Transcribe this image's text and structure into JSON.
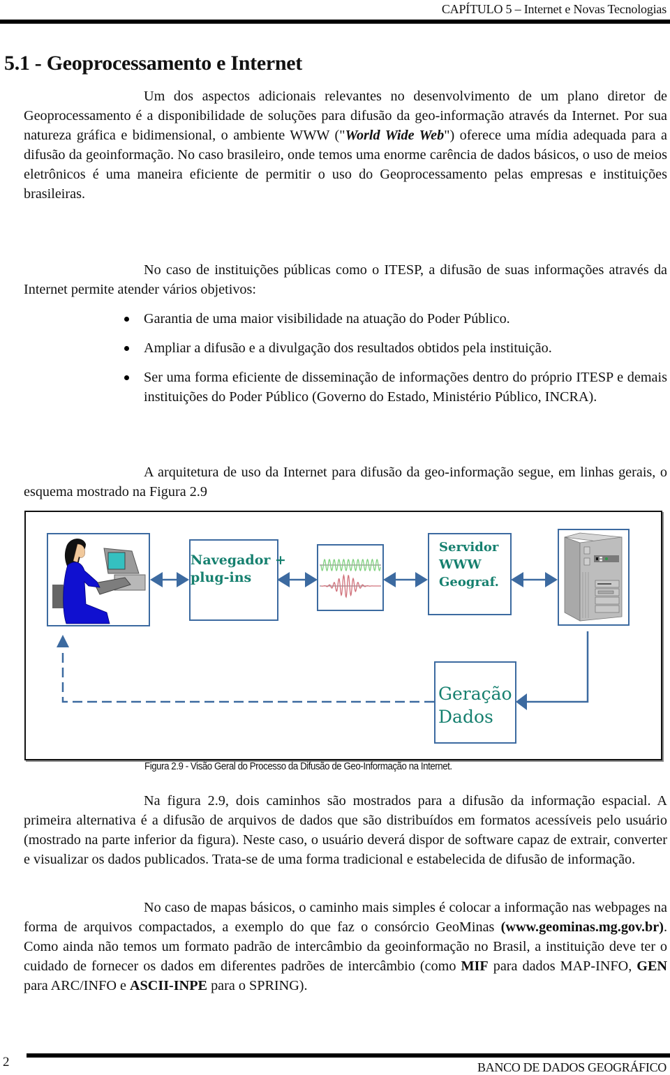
{
  "header": {
    "running_head": "CAPÍTULO 5 – Internet e Novas Tecnologias"
  },
  "section": {
    "title": "5.1 - Geoprocessamento e Internet"
  },
  "paragraphs": {
    "p1": {
      "part1": "Um dos aspectos adicionais relevantes no desenvolvimento de um plano diretor de Geoprocessamento é a disponibilidade de soluções para difusão da geo-informação através da Internet. Por sua natureza gráfica e bidimensional, o ambiente WWW (\"",
      "emph": "World Wide Web",
      "part2": "\") oferece uma mídia adequada para a difusão da geoinformação. No caso brasileiro, onde temos uma enorme carência de dados básicos, o uso de meios eletrônicos é uma maneira eficiente de permitir o uso do Geoprocessamento pelas empresas e instituições brasileiras."
    },
    "p2": "No caso de instituições públicas como o ITESP, a difusão de suas informações através da Internet permite atender vários objetivos:",
    "bullets": [
      "Garantia de uma maior visibilidade na atuação do Poder Público.",
      "Ampliar a difusão e a divulgação dos resultados obtidos pela instituição.",
      "Ser uma forma eficiente de disseminação de informações dentro do próprio ITESP e demais instituições do Poder Público (Governo do Estado, Ministério Público, INCRA)."
    ],
    "p3": "A arquitetura de uso da Internet para difusão da geo-informação segue, em linhas gerais, o esquema mostrado na Figura 2.9",
    "p4": "Na figura 2.9, dois caminhos são mostrados para a difusão da informação espacial. A primeira alternativa é a difusão de arquivos de dados que são distribuídos em formatos acessíveis pelo usuário (mostrado na parte inferior da figura). Neste caso, o usuário deverá dispor de software capaz de extrair, converter e visualizar os dados publicados. Trata-se de uma forma tradicional e estabelecida de difusão de informação.",
    "p5": {
      "part1": "No caso de mapas básicos, o caminho mais simples é colocar a informação nas webpages na forma de arquivos compactados, a exemplo do que faz o consórcio GeoMinas ",
      "link": "(www.geominas.mg.gov.br)",
      "part2": ". Como ainda não temos um formato padrão de intercâmbio da geoinformação no Brasil, a instituição deve ter o cuidado de fornecer os dados em diferentes padrões de intercâmbio (como ",
      "fmt1": "MIF",
      "part3": " para dados MAP-INFO, ",
      "fmt2": "GEN",
      "part4": " para ARC/INFO e ",
      "fmt3": "ASCII-INPE",
      "part5": " para o SPRING)."
    }
  },
  "figure": {
    "nodes": {
      "user": "user-at-computer",
      "browser": {
        "line1": "Navegador +",
        "line2": "plug-ins"
      },
      "network": "signal-waves",
      "server": {
        "line1": "Servidor",
        "line2": "WWW",
        "line3": "Geograf."
      },
      "hardware": "server-tower",
      "data": {
        "line1": "Geração",
        "line2": "Dados"
      }
    },
    "colors": {
      "box_border": "#3c6aa0",
      "arrow": "#3c6aa0",
      "label_text": "#16806f",
      "wave_top": "#7fd07f",
      "wave_bottom": "#d0707a"
    },
    "caption": "Figura 2.9 - Visão Geral do Processo da Difusão de Geo-Informação na Internet."
  },
  "footer": {
    "page_number": "2",
    "running_foot": "BANCO DE DADOS GEOGRÁFICO"
  }
}
